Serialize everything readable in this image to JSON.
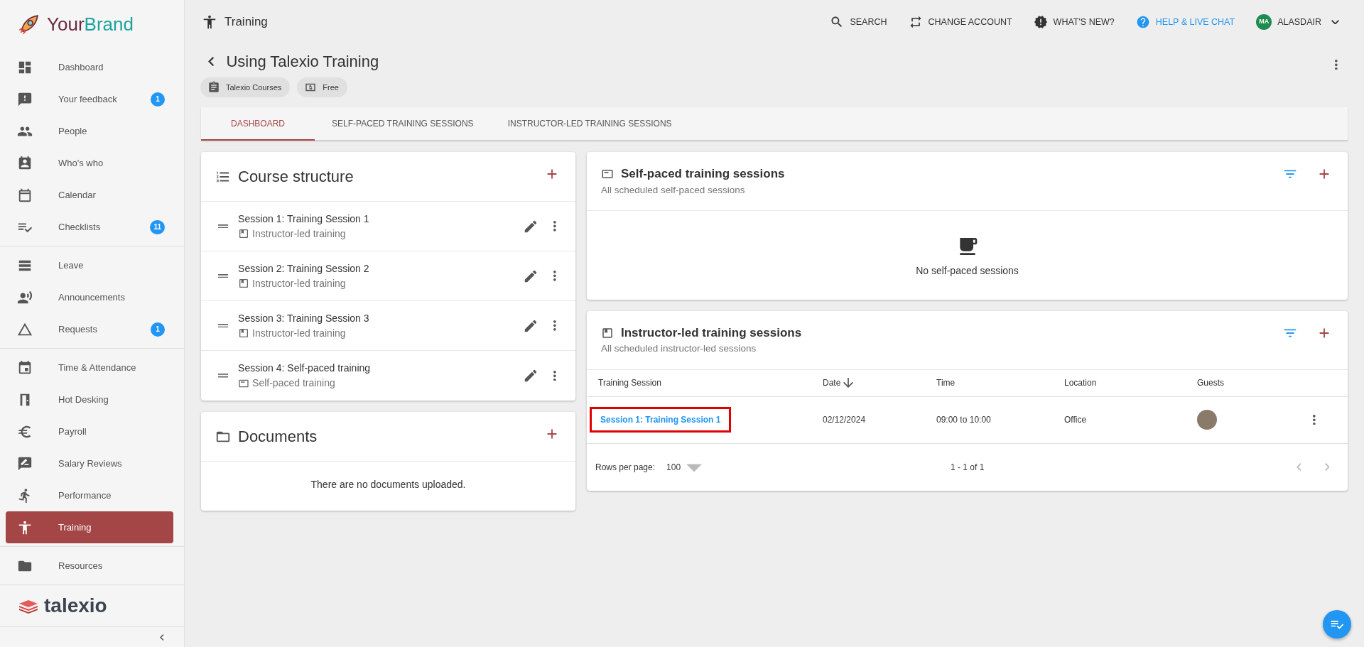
{
  "brand": {
    "parts": [
      "Your",
      "Brand"
    ]
  },
  "sidebar": {
    "groups": [
      [
        {
          "label": "Dashboard",
          "selected": false
        },
        {
          "label": "Your feedback",
          "badge": "1",
          "selected": false
        },
        {
          "label": "People",
          "selected": false
        },
        {
          "label": "Who's who",
          "selected": false
        },
        {
          "label": "Calendar",
          "selected": false
        },
        {
          "label": "Checklists",
          "badge": "11",
          "selected": false
        }
      ],
      [
        {
          "label": "Leave",
          "selected": false
        },
        {
          "label": "Announcements",
          "selected": false
        },
        {
          "label": "Requests",
          "badge": "1",
          "selected": false
        }
      ],
      [
        {
          "label": "Time & Attendance",
          "selected": false
        },
        {
          "label": "Hot Desking",
          "selected": false
        },
        {
          "label": "Payroll",
          "selected": false
        },
        {
          "label": "Salary Reviews",
          "selected": false
        },
        {
          "label": "Performance",
          "selected": false
        },
        {
          "label": "Training",
          "selected": true
        }
      ],
      [
        {
          "label": "Resources",
          "selected": false
        }
      ]
    ],
    "footer_logo": "talexio"
  },
  "topbar": {
    "title": "Training",
    "actions": [
      {
        "label": "SEARCH",
        "kind": "plain"
      },
      {
        "label": "CHANGE ACCOUNT",
        "kind": "plain"
      },
      {
        "label": "WHAT'S NEW?",
        "kind": "plain"
      },
      {
        "label": "HELP & LIVE CHAT",
        "kind": "link"
      }
    ],
    "user": {
      "initials": "MA",
      "name": "ALASDAIR"
    }
  },
  "page": {
    "title": "Using Talexio Training",
    "chips": [
      "Talexio Courses",
      "Free"
    ]
  },
  "tabs": [
    {
      "label": "DASHBOARD",
      "selected": true
    },
    {
      "label": "SELF-PACED TRAINING SESSIONS",
      "selected": false
    },
    {
      "label": "INSTRUCTOR-LED TRAINING SESSIONS",
      "selected": false
    }
  ],
  "course_structure": {
    "title": "Course structure",
    "sessions": [
      {
        "title": "Session 1: Training Session 1",
        "type": "Instructor-led training",
        "kind": "instructor"
      },
      {
        "title": "Session 2: Training Session 2",
        "type": "Instructor-led training",
        "kind": "instructor"
      },
      {
        "title": "Session 3: Training Session 3",
        "type": "Instructor-led training",
        "kind": "instructor"
      },
      {
        "title": "Session 4: Self-paced training",
        "type": "Self-paced training",
        "kind": "self"
      }
    ]
  },
  "documents": {
    "title": "Documents",
    "empty_text": "There are no documents uploaded."
  },
  "self_paced": {
    "title": "Self-paced training sessions",
    "subtitle": "All scheduled self-paced sessions",
    "empty_text": "No self-paced sessions"
  },
  "instructor_led": {
    "title": "Instructor-led training sessions",
    "subtitle": "All scheduled instructor-led sessions",
    "table": {
      "columns": [
        {
          "label": "Training Session",
          "sorted": false
        },
        {
          "label": "Date",
          "sorted": true
        },
        {
          "label": "Time",
          "sorted": false
        },
        {
          "label": "Location",
          "sorted": false
        },
        {
          "label": "Guests",
          "sorted": false
        }
      ],
      "rows": [
        {
          "session": "Session 1: Training Session 1",
          "date": "02/12/2024",
          "time": "09:00 to 10:00",
          "location": "Office",
          "highlighted": true
        }
      ]
    },
    "pagination": {
      "rows_per_page_label": "Rows per page:",
      "rows_per_page": "100",
      "range": "1 - 1 of 1"
    }
  }
}
